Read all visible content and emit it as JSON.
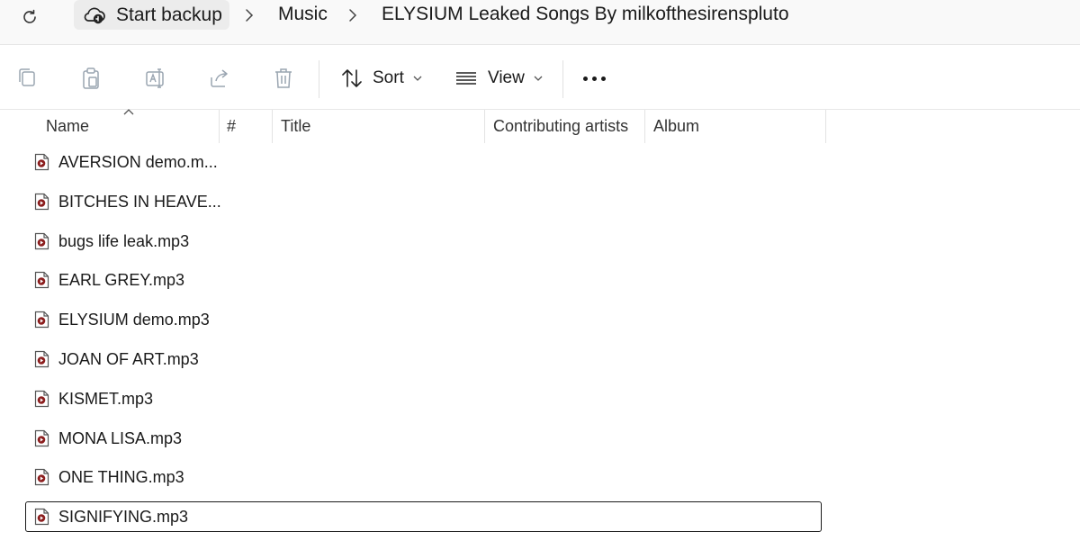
{
  "address_bar": {
    "home_label": "Start backup",
    "path": [
      "Music",
      "ELYSIUM Leaked Songs By milkofthesirenspluto"
    ]
  },
  "toolbar": {
    "icons": [
      "copy-icon",
      "paste-icon",
      "rename-icon",
      "share-icon",
      "delete-icon"
    ],
    "sort_label": "Sort",
    "view_label": "View",
    "more_label": "more-options"
  },
  "columns": {
    "name": "Name",
    "number": "#",
    "title": "Title",
    "contributing_artists": "Contributing artists",
    "album": "Album",
    "sorted_by": "Name",
    "sort_direction": "ascending"
  },
  "files": [
    {
      "name": "AVERSION demo.m...",
      "focused": false
    },
    {
      "name": "BITCHES IN HEAVE...",
      "focused": false
    },
    {
      "name": "bugs life leak.mp3",
      "focused": false
    },
    {
      "name": "EARL GREY.mp3",
      "focused": false
    },
    {
      "name": "ELYSIUM demo.mp3",
      "focused": false
    },
    {
      "name": "JOAN OF ART.mp3",
      "focused": false
    },
    {
      "name": "KISMET.mp3",
      "focused": false
    },
    {
      "name": "MONA LISA.mp3",
      "focused": false
    },
    {
      "name": "ONE THING.mp3",
      "focused": false
    },
    {
      "name": "SIGNIFYING.mp3",
      "focused": true
    }
  ],
  "colors": {
    "file_icon_accent": "#8b1d1d",
    "disabled_icon": "#9aa5b1",
    "focus_border": "#1a1a1a"
  }
}
